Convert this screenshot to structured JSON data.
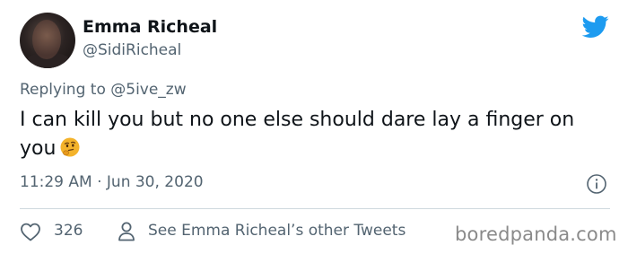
{
  "author": {
    "name": "Emma Richeal",
    "handle": "@SidiRicheal"
  },
  "reply": {
    "prefix": "Replying to",
    "mention": "@5ive_zw"
  },
  "tweet": {
    "text": "I can kill you but no one else should dare lay a finger on you",
    "emoji": "thinking-face"
  },
  "meta": {
    "timestamp": "11:29 AM · Jun 30, 2020"
  },
  "actions": {
    "like_count": "326",
    "see_other": "See Emma Richeal’s other Tweets"
  },
  "watermark": "boredpanda.com",
  "colors": {
    "twitter_blue": "#1d9bf0",
    "secondary_text": "#536471",
    "primary_text": "#0f1419"
  }
}
